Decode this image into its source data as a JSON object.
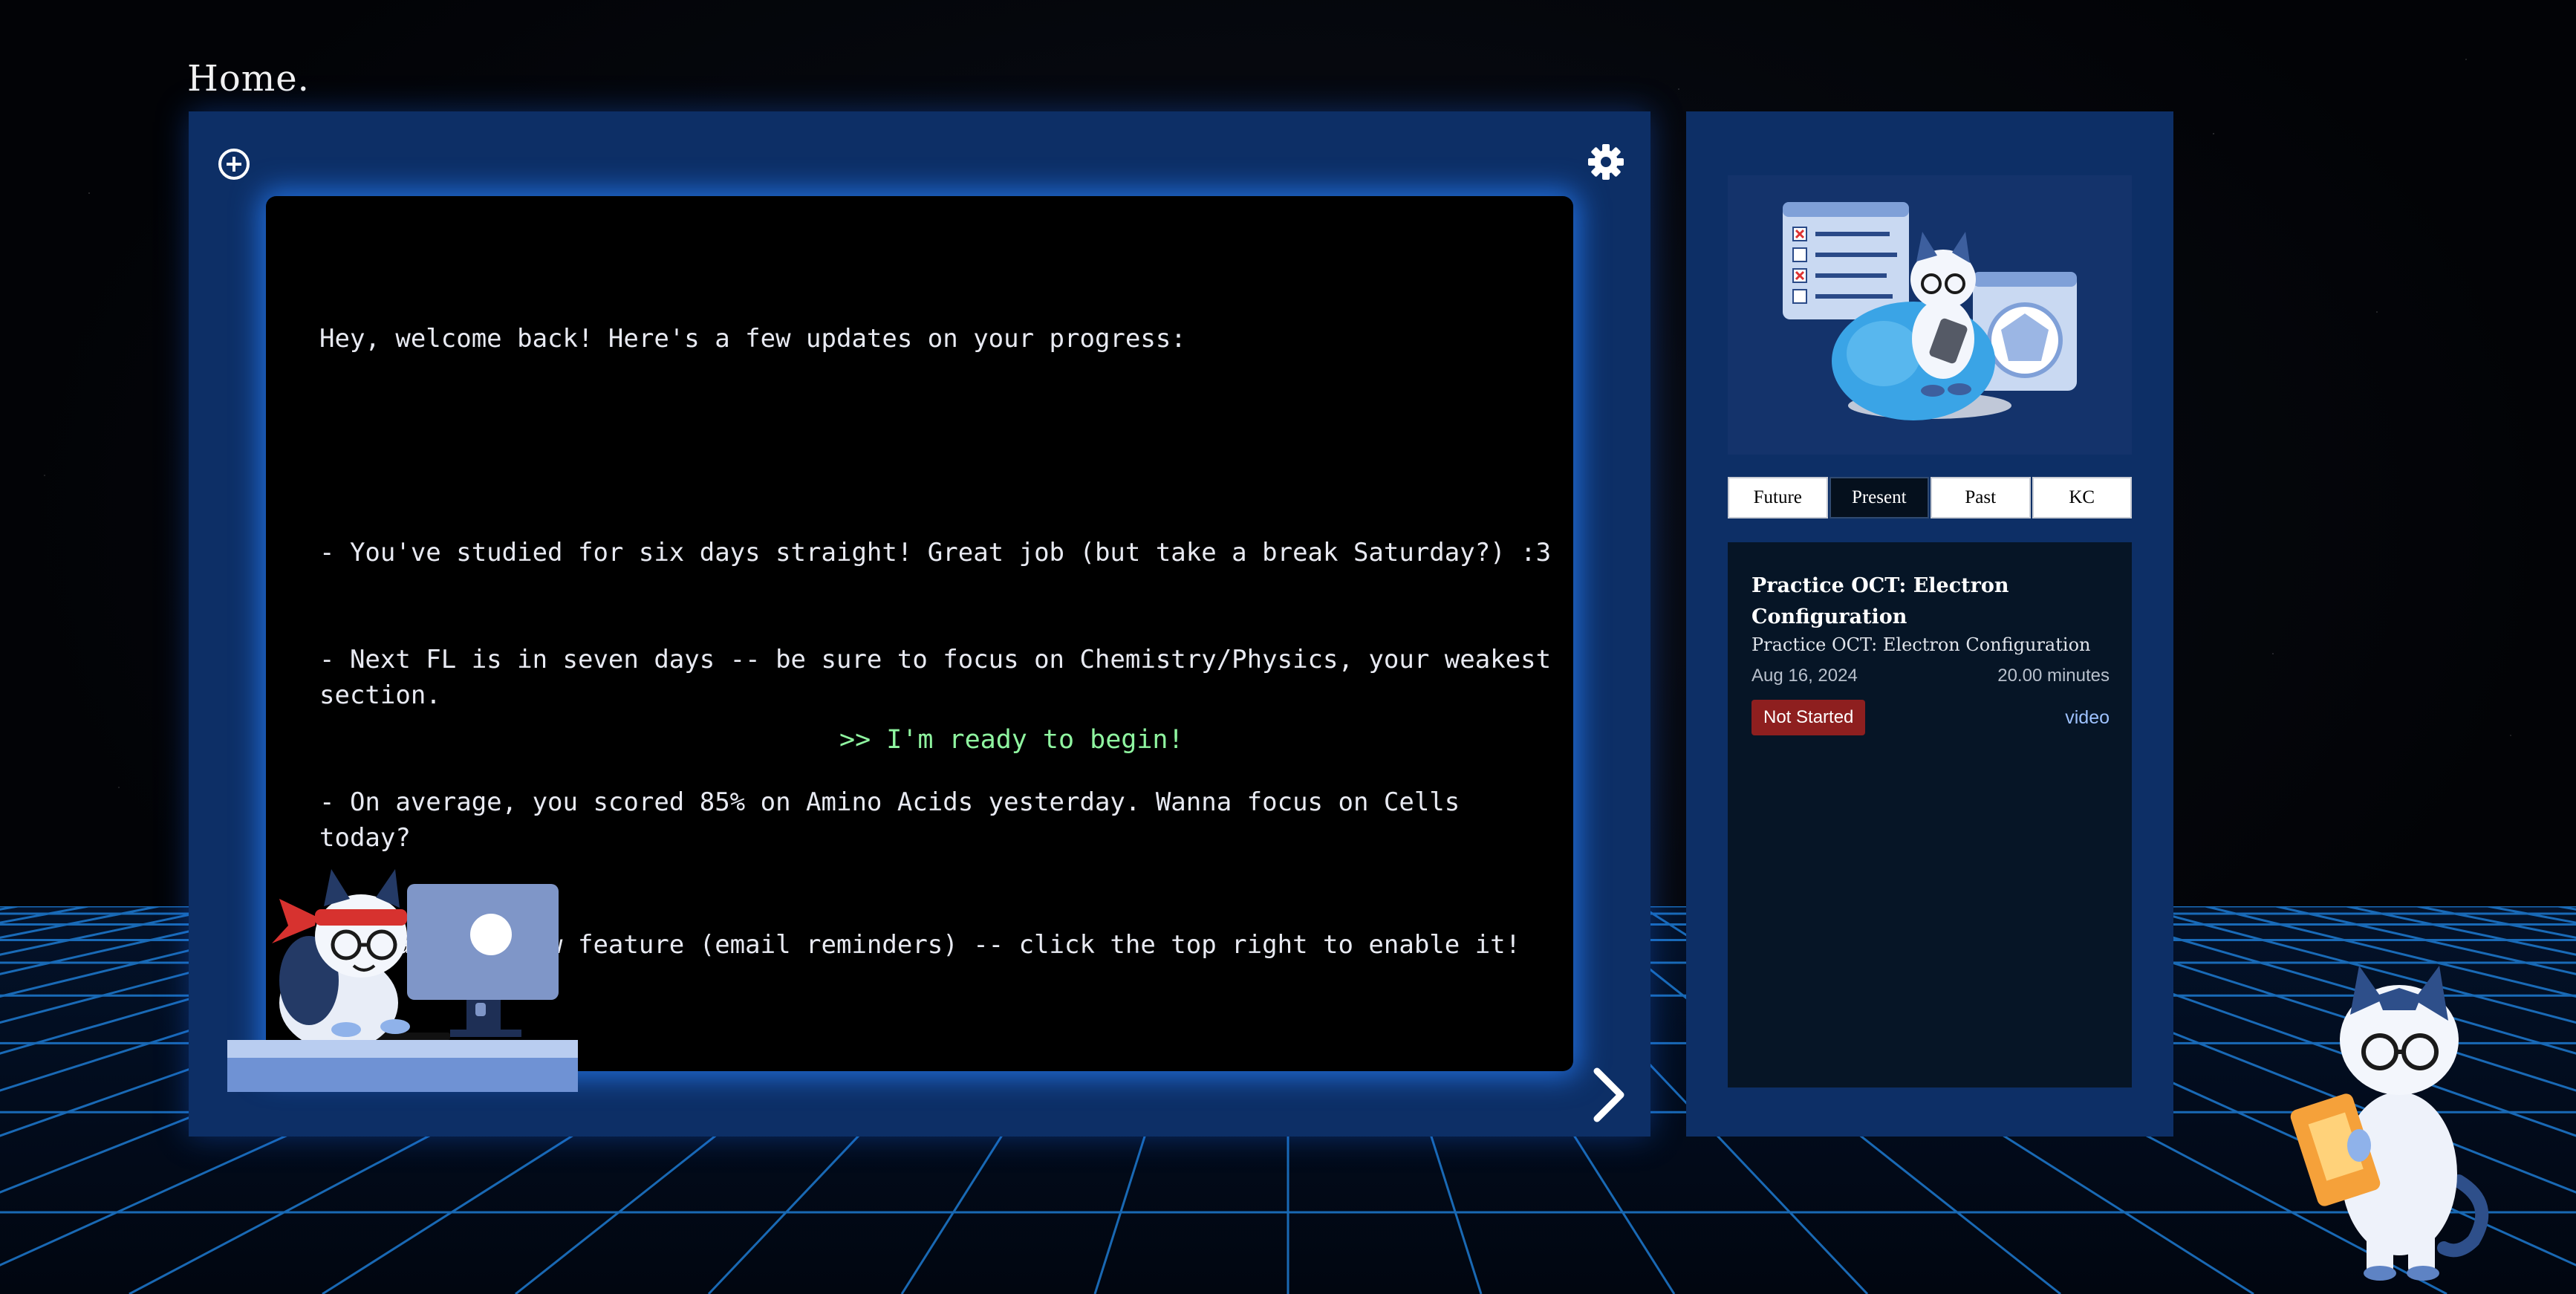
{
  "page": {
    "title": "Home."
  },
  "main": {
    "add_icon": "plus-circle-icon",
    "settings_icon": "gear-icon",
    "terminal": {
      "lines": [
        "Hey, welcome back! Here's a few updates on your progress:",
        "",
        "- You've studied for six days straight! Great job (but take a break Saturday?) :3",
        "- Next FL is in seven days -- be sure to focus on Chemistry/Physics, your weakest section.",
        "- On average, you scored 85% on Amino Acids yesterday. Wanna focus on Cells today?",
        "- We added a new feature (email reminders) -- click the top right to enable it!"
      ],
      "ready_label": ">> I'm ready to begin!",
      "next_icon": "chevron-right-icon"
    }
  },
  "side": {
    "tabs": [
      {
        "label": "Future",
        "active": false
      },
      {
        "label": "Present",
        "active": true
      },
      {
        "label": "Past",
        "active": false
      },
      {
        "label": "KC",
        "active": false
      }
    ],
    "task": {
      "title": "Practice OCT: Electron Configuration",
      "subtitle": "Practice OCT: Electron Configuration",
      "date": "Aug 16, 2024",
      "duration": "20.00 minutes",
      "status": "Not Started",
      "type": "video"
    }
  },
  "colors": {
    "panel": "#0d2f66",
    "terminal_glow": "#2882ff",
    "ready_text": "#8ff5a0",
    "status_not_started": "#8e1f1f",
    "link": "#9ec2ff"
  }
}
